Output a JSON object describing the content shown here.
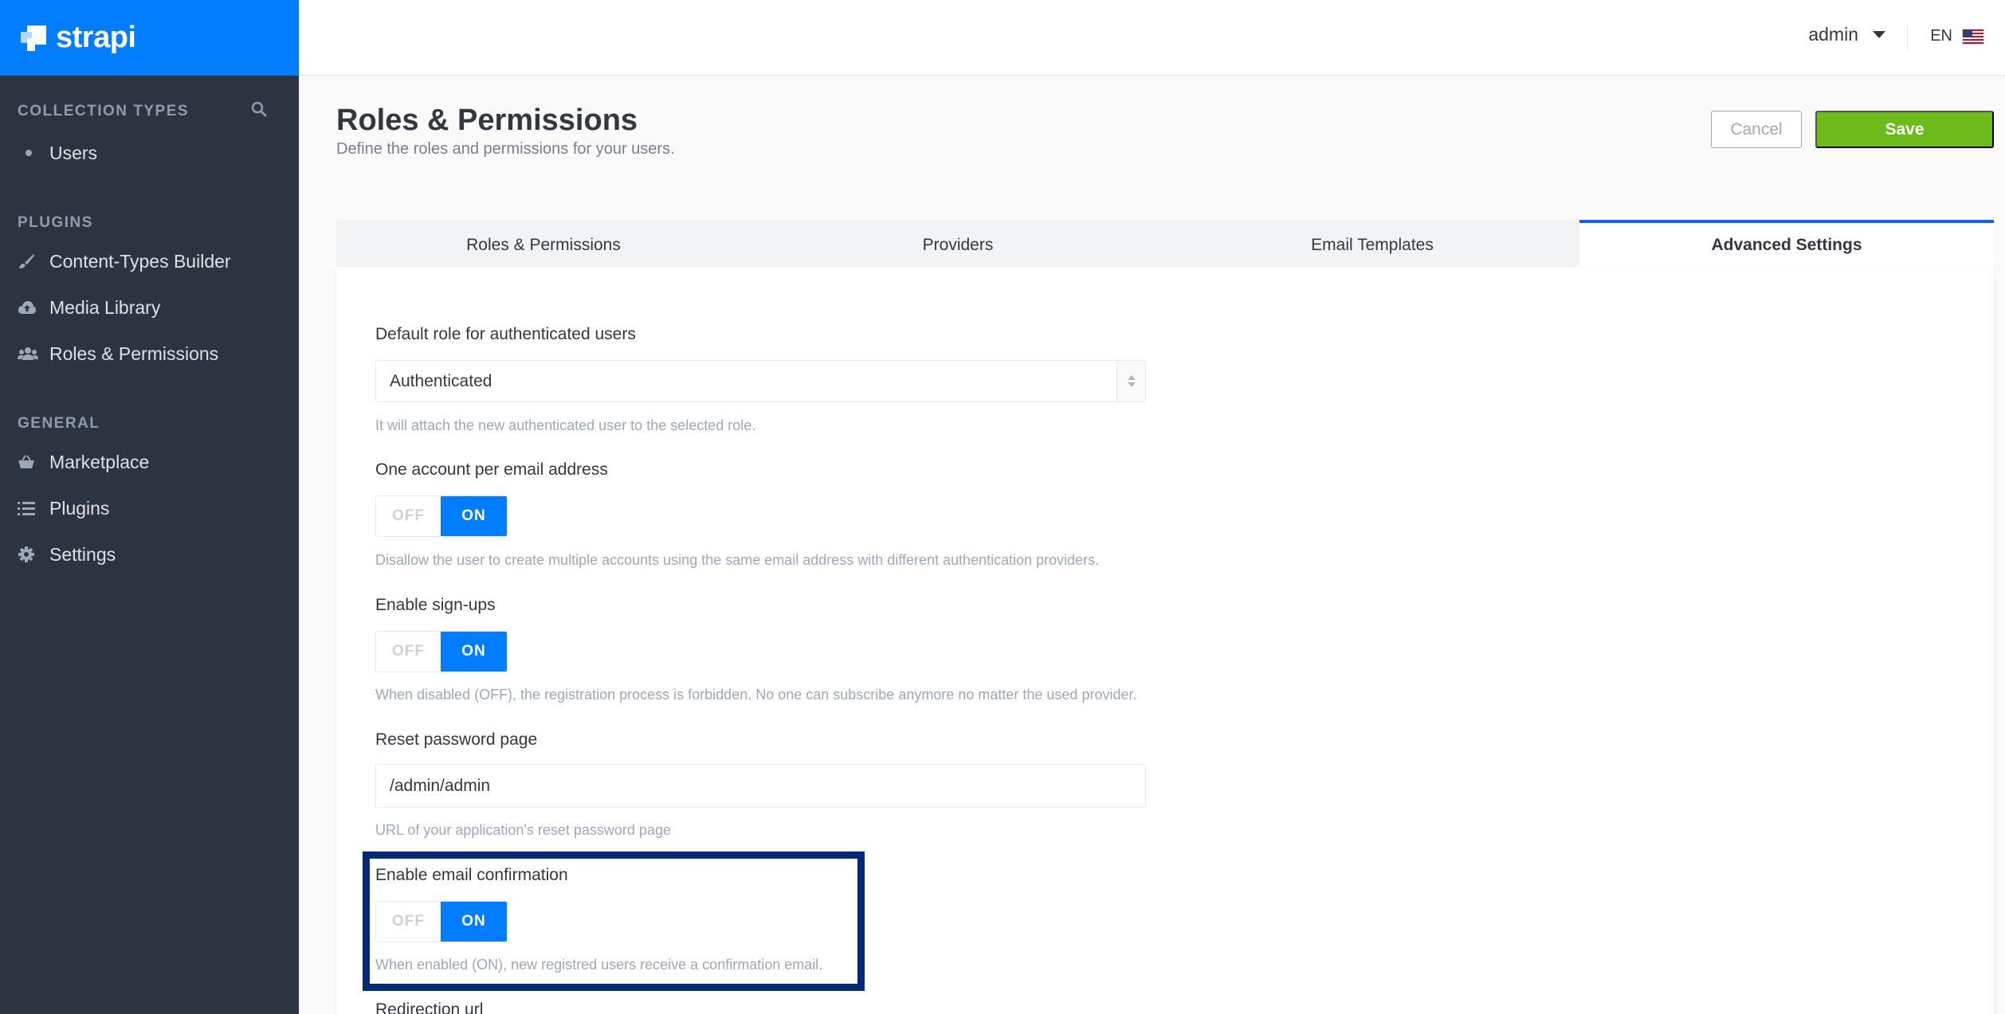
{
  "brand": {
    "name": "strapi"
  },
  "sidebar": {
    "collection_types_title": "COLLECTION TYPES",
    "collection_items": [
      {
        "label": "Users"
      }
    ],
    "plugins_title": "PLUGINS",
    "plugin_items": [
      {
        "label": "Content-Types Builder",
        "icon": "brush-icon"
      },
      {
        "label": "Media Library",
        "icon": "cloud-upload-icon"
      },
      {
        "label": "Roles & Permissions",
        "icon": "users-icon"
      }
    ],
    "general_title": "GENERAL",
    "general_items": [
      {
        "label": "Marketplace",
        "icon": "basket-icon"
      },
      {
        "label": "Plugins",
        "icon": "list-icon"
      },
      {
        "label": "Settings",
        "icon": "gear-icon"
      }
    ]
  },
  "header": {
    "user": "admin",
    "language": "EN"
  },
  "page": {
    "title": "Roles & Permissions",
    "subtitle": "Define the roles and permissions for your users.",
    "cancel_label": "Cancel",
    "save_label": "Save"
  },
  "tabs": [
    {
      "label": "Roles & Permissions",
      "active": false
    },
    {
      "label": "Providers",
      "active": false
    },
    {
      "label": "Email Templates",
      "active": false
    },
    {
      "label": "Advanced Settings",
      "active": true
    }
  ],
  "form": {
    "default_role": {
      "label": "Default role for authenticated users",
      "value": "Authenticated",
      "help": "It will attach the new authenticated user to the selected role."
    },
    "unique_email": {
      "label": "One account per email address",
      "off": "OFF",
      "on": "ON",
      "value": "ON",
      "help": "Disallow the user to create multiple accounts using the same email address with different authentication providers."
    },
    "allow_register": {
      "label": "Enable sign-ups",
      "off": "OFF",
      "on": "ON",
      "value": "ON",
      "help": "When disabled (OFF), the registration process is forbidden. No one can subscribe anymore no matter the used provider."
    },
    "reset_password": {
      "label": "Reset password page",
      "value": "/admin/admin",
      "help": "URL of your application's reset password page"
    },
    "email_confirmation": {
      "label": "Enable email confirmation",
      "off": "OFF",
      "on": "ON",
      "value": "ON",
      "help": "When enabled (ON), new registred users receive a confirmation email."
    },
    "redirection_url": {
      "label": "Redirection url"
    }
  },
  "colors": {
    "sidebar_bg": "#2e3342",
    "brand_blue": "#007eff",
    "save_green": "#6dbb1a",
    "highlight_border": "#002a78",
    "active_tab_border": "#1c5de7"
  }
}
